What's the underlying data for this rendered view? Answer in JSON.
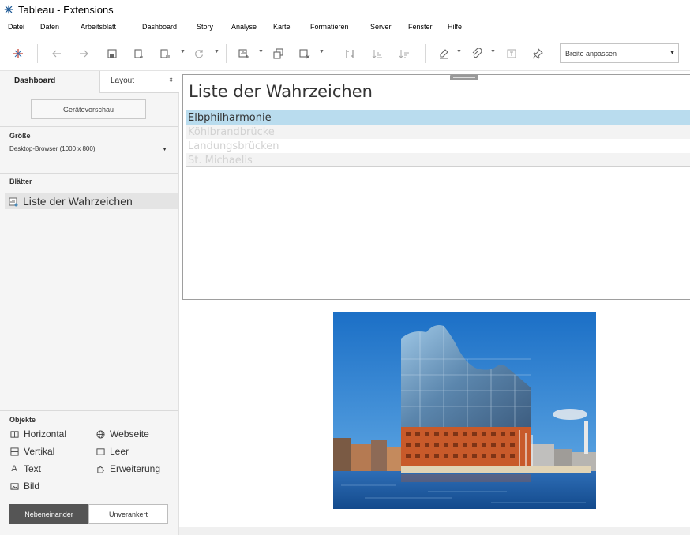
{
  "window": {
    "title": "Tableau - Extensions"
  },
  "menu": [
    "Datei",
    "Daten",
    "Arbeitsblatt",
    "Dashboard",
    "Story",
    "Analyse",
    "Karte",
    "Formatieren",
    "Server",
    "Fenster",
    "Hilfe"
  ],
  "toolbar": {
    "fit_select": "Breite anpassen"
  },
  "left_pane": {
    "tabs": {
      "dashboard": "Dashboard",
      "layout": "Layout"
    },
    "device_preview_button": "Gerätevorschau",
    "size": {
      "heading": "Größe",
      "value": "Desktop-Browser (1000 x 800)"
    },
    "sheets": {
      "heading": "Blätter",
      "items": [
        "Liste der Wahrzeichen"
      ]
    },
    "objects": {
      "heading": "Objekte",
      "items": [
        "Horizontal",
        "Webseite",
        "Vertikal",
        "Leer",
        "Text",
        "Erweiterung",
        "Bild"
      ]
    },
    "layout_toggle": {
      "tiled": "Nebeneinander",
      "floating": "Unverankert"
    }
  },
  "dashboard": {
    "extension": {
      "title": "Liste der Wahrzeichen",
      "items": [
        "Elbphilharmonie",
        "Köhlbrandbrücke",
        "Landungsbrücken",
        "St. Michaelis"
      ],
      "selected_index": 0
    }
  },
  "colors": {
    "selection": "#b9dcee",
    "segment_active": "#555555",
    "tableau_blue": "#1f5a96"
  }
}
